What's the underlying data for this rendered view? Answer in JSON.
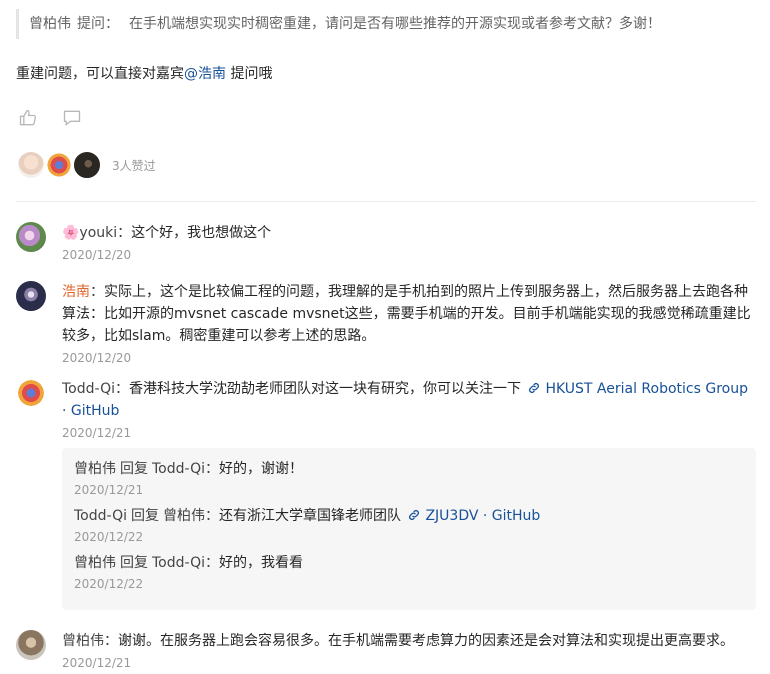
{
  "quote": {
    "author": "曾柏伟",
    "label": "提问：",
    "text": "在手机端想实现实时稠密重建，请问是否有哪些推荐的开源实现或者参考文献？多谢！"
  },
  "answer": {
    "prefix": "重建问题，可以直接对嘉宾",
    "mention": "@浩南",
    "suffix": " 提问哦"
  },
  "likes": {
    "count_text": "3人赞过"
  },
  "comments": [
    {
      "author": "🌸youki",
      "text": "这个好，我也想做这个",
      "date": "2020/12/20"
    },
    {
      "author": "浩南",
      "text": "实际上，这个是比较偏工程的问题，我理解的是手机拍到的照片上传到服务器上，然后服务器上去跑各种算法：比如开源的mvsnet cascade mvsnet这些，需要手机端的开发。目前手机端能实现的我感觉稀疏重建比较多，比如slam。稠密重建可以参考上述的思路。",
      "date": "2020/12/20"
    },
    {
      "author": "Todd-Qi",
      "text": "香港科技大学沈劭劼老师团队对这一块有研究，你可以关注一下",
      "link_text": "HKUST Aerial Robotics Group · GitHub",
      "date": "2020/12/21"
    },
    {
      "author": "曾柏伟",
      "text": "谢谢。在服务器上跑会容易很多。在手机端需要考虑算力的因素还是会对算法和实现提出更高要求。",
      "date": "2020/12/21"
    }
  ],
  "replies": [
    {
      "from": "曾柏伟",
      "reply_word": "回复",
      "to": "Todd-Qi",
      "text": "好的，谢谢！",
      "date": "2020/12/21"
    },
    {
      "from": "Todd-Qi",
      "reply_word": "回复",
      "to": "曾柏伟",
      "text": "还有浙江大学章国锋老师团队",
      "link_text": "ZJU3DV · GitHub",
      "date": "2020/12/22"
    },
    {
      "from": "曾柏伟",
      "reply_word": "回复",
      "to": "Todd-Qi",
      "text": "好的，我看看",
      "date": "2020/12/22"
    }
  ],
  "colors": {
    "accent_author": "#e0662c",
    "link": "#175199",
    "muted": "#999999",
    "reply_bg": "#f6f6f6"
  },
  "icons": [
    "thumbs-up-icon",
    "comment-icon",
    "link-icon"
  ]
}
